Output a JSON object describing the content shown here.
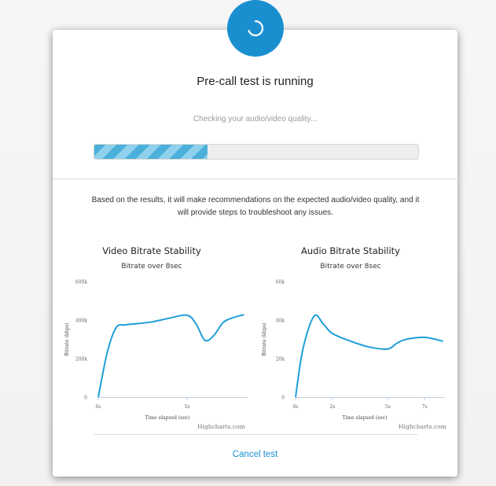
{
  "dialog": {
    "title": "Pre-call test is running",
    "status": "Checking your audio/video quality...",
    "progress_fraction": 0.35,
    "description": "Based on the results, it will make recommendations on the expected audio/video quality, and it will provide steps to troubleshoot any issues.",
    "cancel_label": "Cancel test",
    "accent_color": "#1a8fd0"
  },
  "chart_data": [
    {
      "type": "line",
      "title": "Video Bitrate Stability",
      "subtitle": "Bitrate over 8sec",
      "xlabel": "Time elapsed (sec)",
      "ylabel": "Bitrate (kbps)",
      "xlim": [
        0,
        8.4
      ],
      "ylim": [
        0,
        600000
      ],
      "y_ticks": [
        "0",
        "200k",
        "400k",
        "600k"
      ],
      "x_ticks": [
        "0s",
        "5s"
      ],
      "series": [
        {
          "x": [
            0,
            0.5,
            1,
            1.5,
            2,
            3,
            4,
            5,
            5.5,
            6,
            6.5,
            7,
            7.5,
            8.2
          ],
          "values": [
            0,
            230000,
            360000,
            375000,
            380000,
            390000,
            410000,
            425000,
            380000,
            295000,
            320000,
            385000,
            410000,
            428000
          ]
        }
      ],
      "credit": "Highcharts.com"
    },
    {
      "type": "line",
      "title": "Audio Bitrate Stability",
      "subtitle": "Bitrate over 8sec",
      "xlabel": "Time elapsed (sec)",
      "ylabel": "Bitrate (kbps)",
      "xlim": [
        0,
        8.1
      ],
      "ylim": [
        0,
        60000
      ],
      "y_ticks": [
        "0",
        "20k",
        "40k",
        "60k"
      ],
      "x_ticks": [
        "0s",
        "2s",
        "5s",
        "7s"
      ],
      "series": [
        {
          "x": [
            0,
            0.4,
            1,
            1.5,
            2,
            3,
            4,
            5,
            5.5,
            6,
            7,
            8
          ],
          "values": [
            0,
            25000,
            42000,
            38000,
            33000,
            29000,
            26000,
            25000,
            28000,
            30000,
            31000,
            29000
          ]
        }
      ],
      "credit": "Highcharts.com"
    }
  ]
}
